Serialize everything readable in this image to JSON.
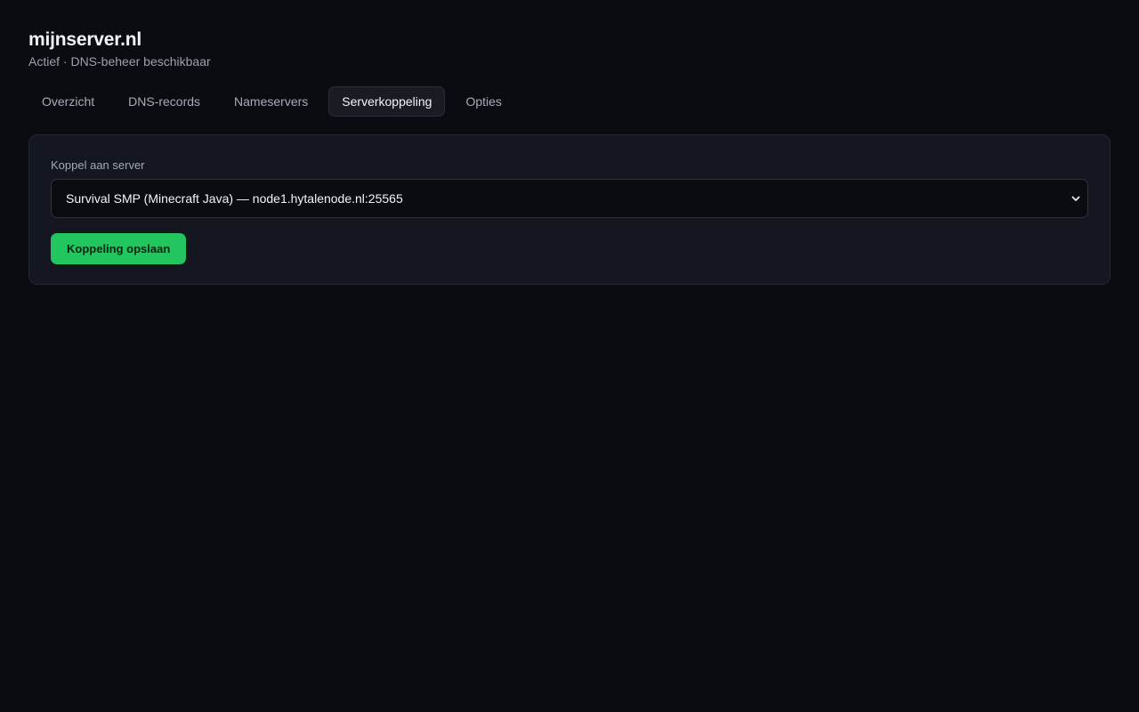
{
  "header": {
    "title": "mijnserver.nl",
    "subtitle": "Actief · DNS-beheer beschikbaar"
  },
  "tabs": [
    {
      "label": "Overzicht",
      "active": false
    },
    {
      "label": "DNS-records",
      "active": false
    },
    {
      "label": "Nameservers",
      "active": false
    },
    {
      "label": "Serverkoppeling",
      "active": true
    },
    {
      "label": "Opties",
      "active": false
    }
  ],
  "link_card": {
    "label": "Koppel aan server",
    "selected_server": "Survival SMP (Minecraft Java) — node1.hytalenode.nl:25565",
    "save_label": "Koppeling opslaan"
  },
  "colors": {
    "background": "#0b0c12",
    "card": "#141720",
    "accent": "#22c55e"
  }
}
